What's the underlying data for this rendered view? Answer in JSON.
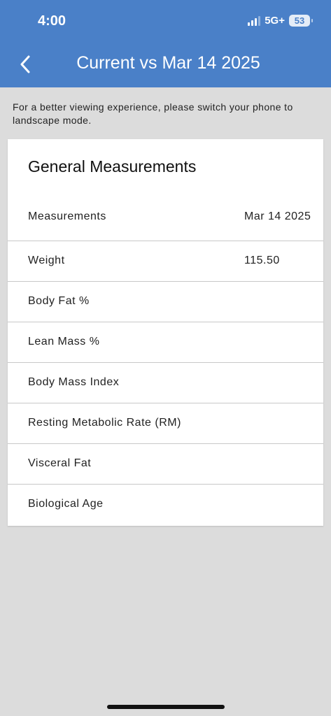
{
  "status_bar": {
    "time": "4:00",
    "network": "5G+",
    "battery": "53"
  },
  "nav": {
    "title": "Current vs Mar 14 2025",
    "back_icon": "chevron-left-icon"
  },
  "notice": "For a better viewing experience, please switch your phone to landscape mode.",
  "card": {
    "title": "General Measurements",
    "columns": [
      "Measurements",
      "Mar 14 2025"
    ],
    "rows": [
      {
        "label": "Weight",
        "value": "115.50"
      },
      {
        "label": "Body Fat %",
        "value": ""
      },
      {
        "label": "Lean Mass %",
        "value": ""
      },
      {
        "label": "Body Mass Index",
        "value": ""
      },
      {
        "label": "Resting Metabolic Rate (RM)",
        "value": ""
      },
      {
        "label": "Visceral Fat",
        "value": ""
      },
      {
        "label": "Biological Age",
        "value": ""
      }
    ]
  },
  "colors": {
    "header": "#4a80c8",
    "background": "#dcdcdc",
    "card": "#ffffff"
  }
}
